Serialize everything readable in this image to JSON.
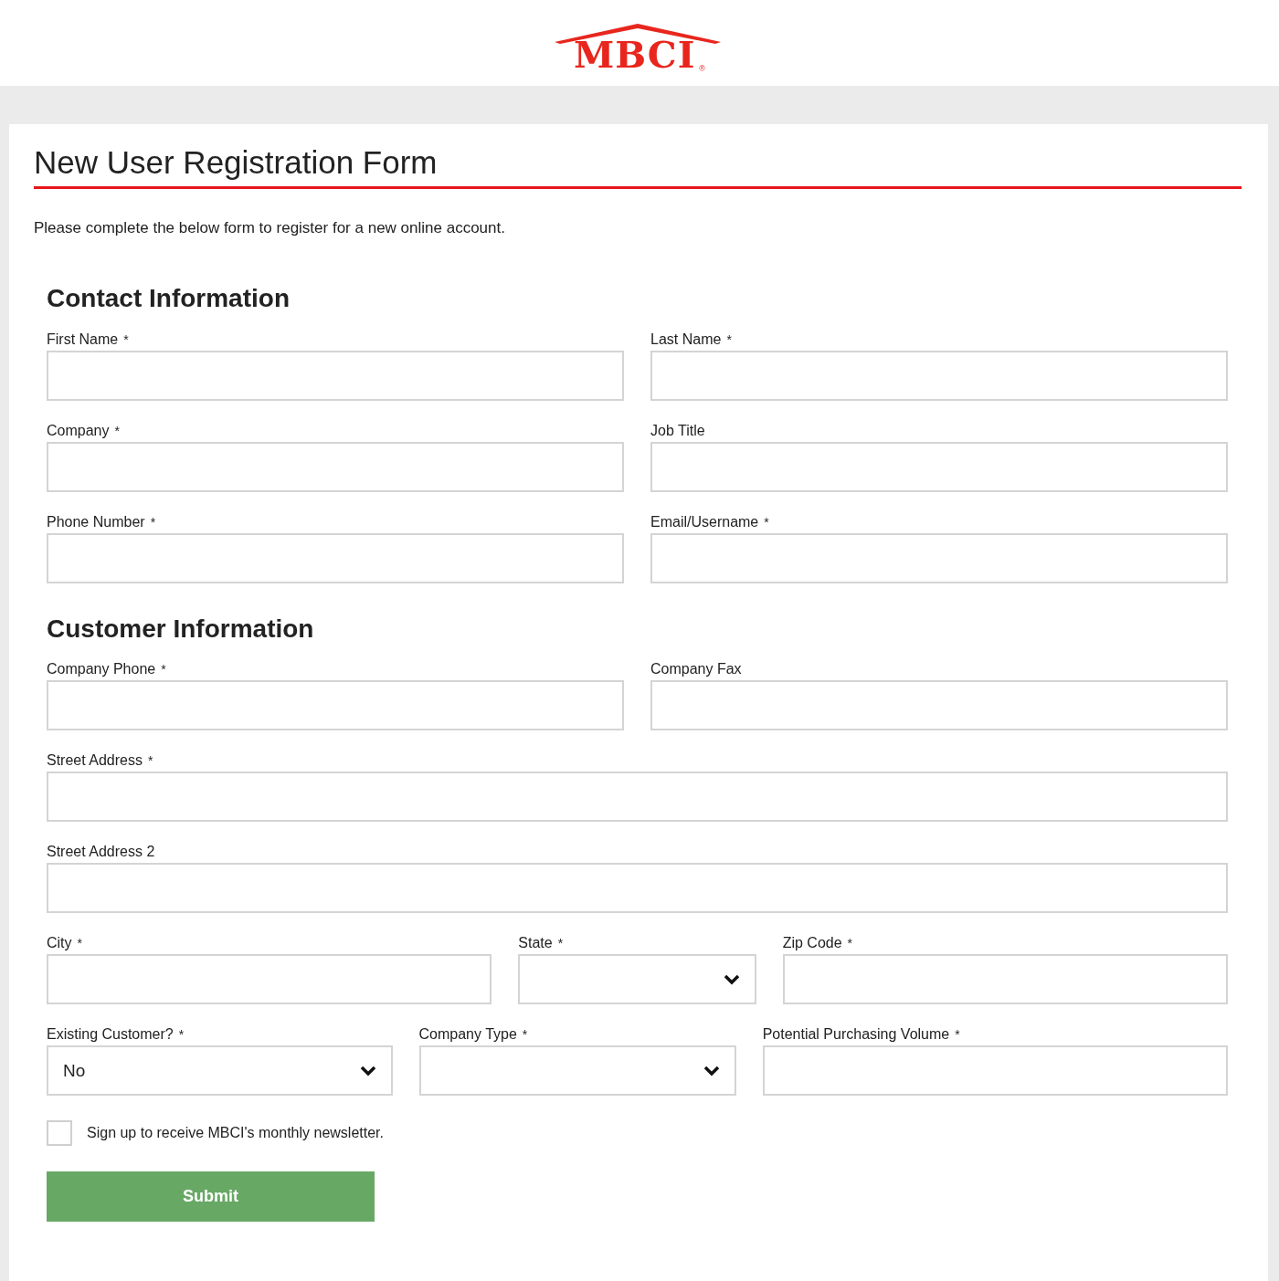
{
  "logo": {
    "text": "MBCI",
    "mark": "®"
  },
  "form": {
    "title": "New User Registration Form",
    "intro": "Please complete the below form to register for a new online account.",
    "sections": [
      {
        "heading": "Contact Information",
        "rows": [
          [
            {
              "label": "First Name",
              "asterisk": "*",
              "kind": "text"
            },
            {
              "label": "Last Name",
              "asterisk": "*",
              "kind": "text"
            }
          ],
          [
            {
              "label": "Company",
              "asterisk": "*",
              "kind": "text"
            },
            {
              "label": "Job Title",
              "kind": "text"
            }
          ],
          [
            {
              "label": "Phone Number",
              "asterisk": "*",
              "kind": "text"
            },
            {
              "label": "Email/Username",
              "asterisk": "*",
              "kind": "text"
            }
          ]
        ]
      },
      {
        "heading": "Customer Information",
        "rows": [
          [
            {
              "label": "Company Phone",
              "asterisk": "*",
              "kind": "text"
            },
            {
              "label": "Company Fax",
              "kind": "text"
            }
          ],
          [
            {
              "label": "Street Address",
              "asterisk": "*",
              "kind": "text"
            }
          ],
          [
            {
              "label": "Street Address 2",
              "kind": "text"
            }
          ],
          [
            {
              "label": "City",
              "asterisk": "*",
              "kind": "text"
            },
            {
              "label": "State",
              "asterisk": "*",
              "kind": "select"
            },
            {
              "label": "Zip Code",
              "asterisk": "*",
              "kind": "text"
            }
          ],
          [
            {
              "label": "Existing Customer?",
              "asterisk": "*",
              "kind": "select",
              "value": "No"
            },
            {
              "label": "Company Type",
              "asterisk": "*",
              "kind": "select"
            },
            {
              "label": "Potential Purchasing Volume",
              "asterisk": "*",
              "kind": "text"
            }
          ]
        ]
      }
    ],
    "newsletter": {
      "label": "Sign up to receive MBCI's monthly newsletter.",
      "checked": false
    },
    "submit": "Submit"
  }
}
